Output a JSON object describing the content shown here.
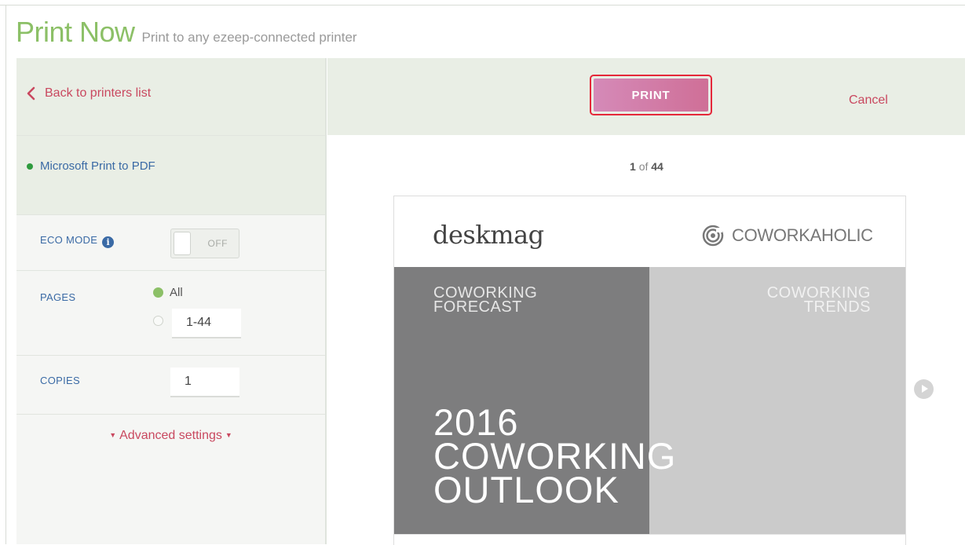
{
  "header": {
    "title": "Print Now",
    "subtitle": "Print to any ezeep-connected printer"
  },
  "sidebar": {
    "back_label": "Back to printers list",
    "printer_name": "Microsoft Print to PDF",
    "printer_status_color": "#2f9b3e",
    "eco_mode": {
      "label": "ECO MODE",
      "info_icon": "i",
      "toggle_state": "OFF"
    },
    "pages": {
      "label": "PAGES",
      "option_all": "All",
      "range_value": "1-44",
      "selected": "All"
    },
    "copies": {
      "label": "COPIES",
      "value": "1"
    },
    "advanced_label": "Advanced settings"
  },
  "toolbar": {
    "print_label": "PRINT",
    "cancel_label": "Cancel"
  },
  "preview": {
    "current_page": "1",
    "of_label": "of",
    "total_pages": "44",
    "document": {
      "brand_bold": "desk",
      "brand_rest": "mag",
      "partner": "COWORKAHOLIC",
      "forecast_line1": "COWORKING",
      "forecast_line2": "FORECAST",
      "trends_line1": "COWORKING",
      "trends_line2": "TRENDS",
      "headline_line1": "2016",
      "headline_line2": "COWORKING",
      "headline_line3": "OUTLOOK"
    }
  },
  "colors": {
    "accent_green": "#8cc067",
    "link_red": "#c9485f",
    "label_blue": "#3a6aa5",
    "print_button": "#d27ca8",
    "highlight_border": "#e5283a"
  }
}
